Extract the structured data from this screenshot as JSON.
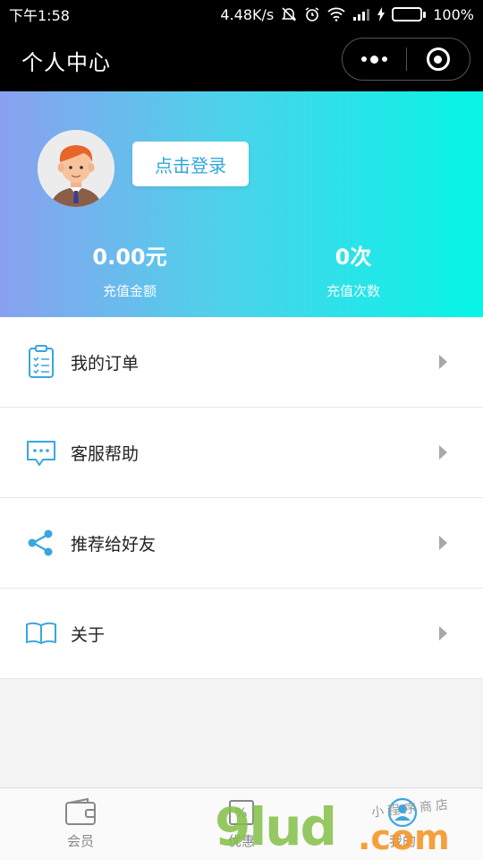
{
  "status_bar": {
    "time": "下午1:58",
    "network_speed": "4.48K/s",
    "battery": "100%"
  },
  "navbar": {
    "title": "个人中心"
  },
  "profile": {
    "login_button": "点击登录",
    "stats": [
      {
        "value": "0.00元",
        "label": "充值金额"
      },
      {
        "value": "0次",
        "label": "充值次数"
      }
    ]
  },
  "menu": [
    {
      "label": "我的订单",
      "icon": "clipboard-icon"
    },
    {
      "label": "客服帮助",
      "icon": "chat-bubble-icon"
    },
    {
      "label": "推荐给好友",
      "icon": "share-icon"
    },
    {
      "label": "关于",
      "icon": "book-icon"
    }
  ],
  "tabbar": [
    {
      "label": "会员",
      "icon": "wallet-icon"
    },
    {
      "label": "优惠",
      "icon": "coupon-icon"
    },
    {
      "label": "我的",
      "icon": "user-icon"
    }
  ],
  "watermark": {
    "main": "9lud",
    "suffix": ".com",
    "sub": "小程序商店"
  },
  "colors": {
    "gradient_start": "#8aa0f0",
    "gradient_end": "#06f5e6",
    "icon_accent": "#3aa6e0",
    "login_text": "#2fa8d8"
  }
}
